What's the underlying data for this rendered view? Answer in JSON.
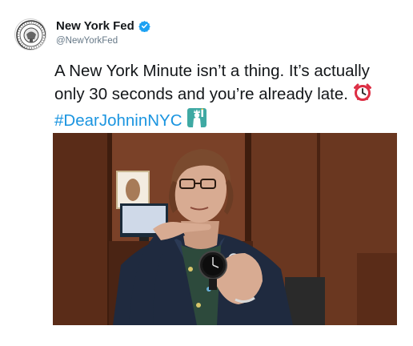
{
  "account": {
    "display_name": "New York Fed",
    "handle": "@NewYorkFed",
    "verified": true,
    "avatar_icon": "federal-reserve-seal-icon"
  },
  "tweet": {
    "text_before": "A New York Minute isn’t a thing. It’s actually only 30 seconds and you’re already late.",
    "emoji_1": "alarm-clock-icon",
    "hashtag": "#DearJohninNYC",
    "emoji_2": "statue-of-liberty-icon",
    "hashtag_color": "#1b95e0"
  },
  "media": {
    "description_icon": "photo-woman-pointing-at-watch"
  }
}
